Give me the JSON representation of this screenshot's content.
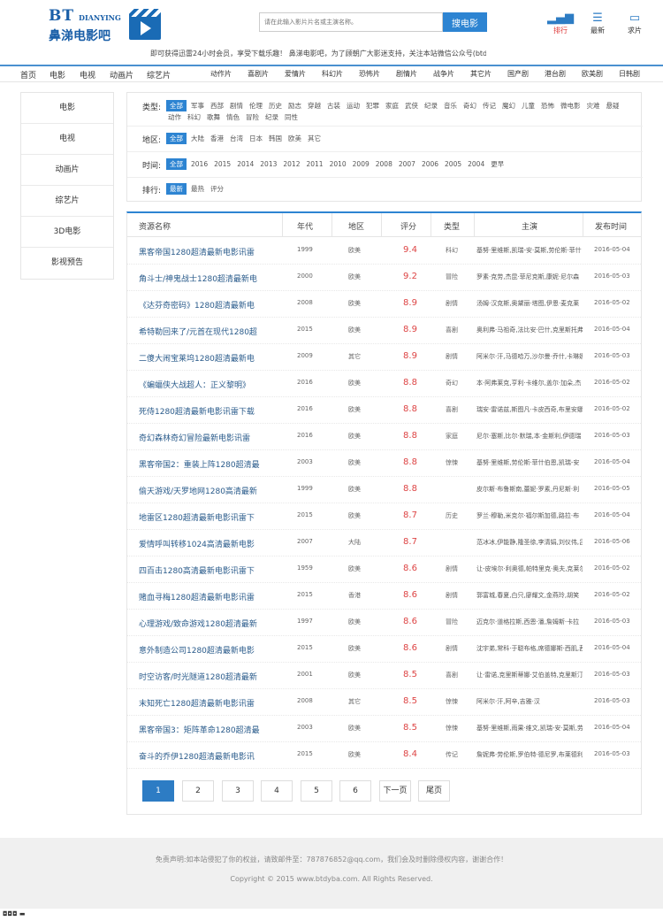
{
  "header": {
    "logo_bt": "BT",
    "logo_en": "DIANYING",
    "logo_cn": "鼻涕电影吧",
    "search_placeholder": "请在此输入影片片名或主演名称。",
    "search_button": "搜电影",
    "icons": [
      {
        "label": "排行",
        "icon": "bar-chart-icon",
        "glyph": "▂▄▆"
      },
      {
        "label": "最新",
        "icon": "list-icon",
        "glyph": "☰"
      },
      {
        "label": "求片",
        "icon": "message-icon",
        "glyph": "▭"
      }
    ]
  },
  "notice": "即可获得迅雷24小时会员，享受下载乐趣！   鼻涕电影吧，为了顾朝广大影迷支持，关注本站微信公众号(btdyba",
  "nav": {
    "left": [
      "首页",
      "电影",
      "电视",
      "动画片",
      "综艺片"
    ],
    "right": [
      "动作片",
      "喜剧片",
      "爱情片",
      "科幻片",
      "恐怖片",
      "剧情片",
      "战争片",
      "其它片",
      "国产剧",
      "港台剧",
      "欧美剧",
      "日韩剧"
    ]
  },
  "sidebar": [
    "电影",
    "电视",
    "动画片",
    "综艺片",
    "3D电影",
    "影视预告"
  ],
  "filters": {
    "type": {
      "label": "类型:",
      "options": [
        "全部",
        "军事",
        "西部",
        "剧情",
        "伦理",
        "历史",
        "励志",
        "穿越",
        "古装",
        "运动",
        "犯罪",
        "家庭",
        "武侠",
        "纪录",
        "音乐",
        "奇幻",
        "传记",
        "魔幻",
        "儿童",
        "恐怖",
        "微电影",
        "灾难",
        "悬疑",
        "动作",
        "科幻",
        "歌舞",
        "情色",
        "冒险",
        "纪录",
        "同性"
      ]
    },
    "region": {
      "label": "地区:",
      "options": [
        "全部",
        "大陆",
        "香港",
        "台湾",
        "日本",
        "韩国",
        "欧美",
        "其它"
      ]
    },
    "year": {
      "label": "时间:",
      "options": [
        "全部",
        "2016",
        "2015",
        "2014",
        "2013",
        "2012",
        "2011",
        "2010",
        "2009",
        "2008",
        "2007",
        "2006",
        "2005",
        "2004",
        "更早"
      ]
    },
    "sort": {
      "label": "排行:",
      "options": [
        "最新",
        "最热",
        "评分"
      ]
    }
  },
  "table": {
    "headers": [
      "资源名称",
      "年代",
      "地区",
      "评分",
      "类型",
      "主演",
      "发布时间"
    ],
    "rows": [
      {
        "title": "黑客帝国1280超清最新电影讯雷",
        "year": "1999",
        "region": "欧美",
        "score": "9.4",
        "type": "科幻",
        "actors": "基努·里维斯,凯瑞-安·莫斯,劳伦斯·菲什",
        "date": "2016-05-04"
      },
      {
        "title": "角斗士/神鬼战士1280超清最新电",
        "year": "2000",
        "region": "欧美",
        "score": "9.2",
        "type": "冒险",
        "actors": "罗素·克劳,杰昆·菲尼克斯,康妮·尼尔森",
        "date": "2016-05-03"
      },
      {
        "title": "《达芬奇密码》1280超清最新电",
        "year": "2008",
        "region": "欧美",
        "score": "8.9",
        "type": "剧情",
        "actors": "汤姆·汉克斯,奥黛丽·塔图,伊恩·麦克莱",
        "date": "2016-05-02"
      },
      {
        "title": "希特勒回来了/元首在现代1280超",
        "year": "2015",
        "region": "欧美",
        "score": "8.9",
        "type": "喜剧",
        "actors": "奥利弗·马祖奇,法比安·巴什,克里斯托弗",
        "date": "2016-05-04"
      },
      {
        "title": "二傻大闹宝莱坞1280超清最新电",
        "year": "2009",
        "region": "其它",
        "score": "8.9",
        "type": "剧情",
        "actors": "阿米尔·汗,马德哈万,沙尔曼·乔什,卡琳娜",
        "date": "2016-05-03"
      },
      {
        "title": "《蝙蝠侠大战超人：正义黎明》",
        "year": "2016",
        "region": "欧美",
        "score": "8.8",
        "type": "奇幻",
        "actors": "本·阿弗莱克,亨利·卡维尔,盖尔·加朵,杰",
        "date": "2016-05-02"
      },
      {
        "title": "死侍1280超清最新电影讯雷下载",
        "year": "2016",
        "region": "欧美",
        "score": "8.8",
        "type": "喜剧",
        "actors": "瑞安·雷诺兹,斯图凡·卡皮西奇,布里安娜",
        "date": "2016-05-02"
      },
      {
        "title": "奇幻森林奇幻冒险最新电影讯雷",
        "year": "2016",
        "region": "欧美",
        "score": "8.8",
        "type": "家庭",
        "actors": "尼尔·塞斯,比尔·默瑞,本·金斯利,伊德瑞",
        "date": "2016-05-03"
      },
      {
        "title": "黑客帝国2：重装上阵1280超清最",
        "year": "2003",
        "region": "欧美",
        "score": "8.8",
        "type": "惊悚",
        "actors": "基努·里维斯,劳伦斯·菲什伯恩,凯瑞-安",
        "date": "2016-05-04"
      },
      {
        "title": "偷天游戏/天罗地网1280高清最新",
        "year": "1999",
        "region": "欧美",
        "score": "8.8",
        "type": "",
        "actors": "皮尔斯·布鲁斯南,蕾妮·罗素,丹尼斯·利",
        "date": "2016-05-05"
      },
      {
        "title": "地雷区1280超清最新电影讯雷下",
        "year": "2015",
        "region": "欧美",
        "score": "8.7",
        "type": "历史",
        "actors": "罗兰·穆勒,米克尔·福尔斯加德,路拉·布",
        "date": "2016-05-04"
      },
      {
        "title": "爱情呼叫转移1024高清最新电影",
        "year": "2007",
        "region": "大陆",
        "score": "8.7",
        "type": "",
        "actors": "范冰冰,伊能静,隆圣徐,李清娟,刘仪伟,吕",
        "date": "2016-05-06"
      },
      {
        "title": "四百击1280高清最新电影讯雷下",
        "year": "1959",
        "region": "欧美",
        "score": "8.6",
        "type": "剧情",
        "actors": "让-皮埃尔·利奥德,帕特里克·奥夫,克莱尔",
        "date": "2016-05-02"
      },
      {
        "title": "赌血寻梅1280超清最新电影讯雷",
        "year": "2015",
        "region": "香港",
        "score": "8.6",
        "type": "剧情",
        "actors": "郭富城,春夏,白只,廖耀文,金燕玲,胡笑",
        "date": "2016-05-02"
      },
      {
        "title": "心理游戏/致命游戏1280超清最新",
        "year": "1997",
        "region": "欧美",
        "score": "8.6",
        "type": "冒险",
        "actors": "迈克尔·道格拉斯,西恩·潘,詹姆斯·卡拉",
        "date": "2016-05-03"
      },
      {
        "title": "意外制造公司1280超清最新电影",
        "year": "2015",
        "region": "欧美",
        "score": "8.6",
        "type": "剧情",
        "actors": "沈宇弟,常科·于聪布格,席德娜斯·西肌,茜",
        "date": "2016-05-04"
      },
      {
        "title": "时空访客/时光隧道1280超清最新",
        "year": "2001",
        "region": "欧美",
        "score": "8.5",
        "type": "喜剧",
        "actors": "让·雷诺,克里斯蒂娜·艾伯盖特,克里斯汀",
        "date": "2016-05-03"
      },
      {
        "title": "末知死亡1280超清最新电影讯雷",
        "year": "2008",
        "region": "其它",
        "score": "8.5",
        "type": "惊悚",
        "actors": "阿米尔·汗,阿辛,吉雅·汉",
        "date": "2016-05-03"
      },
      {
        "title": "黑客帝国3：矩阵革命1280超清最",
        "year": "2003",
        "region": "欧美",
        "score": "8.5",
        "type": "惊悚",
        "actors": "基努·里维斯,雨果·维文,凯瑞-安·莫斯,劳",
        "date": "2016-05-04"
      },
      {
        "title": "奋斗的乔伊1280超清最新电影讯",
        "year": "2015",
        "region": "欧美",
        "score": "8.4",
        "type": "传记",
        "actors": "詹妮弗·劳伦斯,罗伯特·德尼罗,布莱德利",
        "date": "2016-05-03"
      }
    ]
  },
  "pager": [
    "1",
    "2",
    "3",
    "4",
    "5",
    "6",
    "下一页",
    "尾页"
  ],
  "footer": {
    "disclaimer": "免责声明:如本站侵犯了你的权益，请致邮件至：787876852@qq.com，我们会及时删除侵权内容，谢谢合作！",
    "copyright": "Copyright © 2015 www.btdyba.com. All Rights Reserved."
  },
  "statusbar": "◘◘◘ ▬"
}
